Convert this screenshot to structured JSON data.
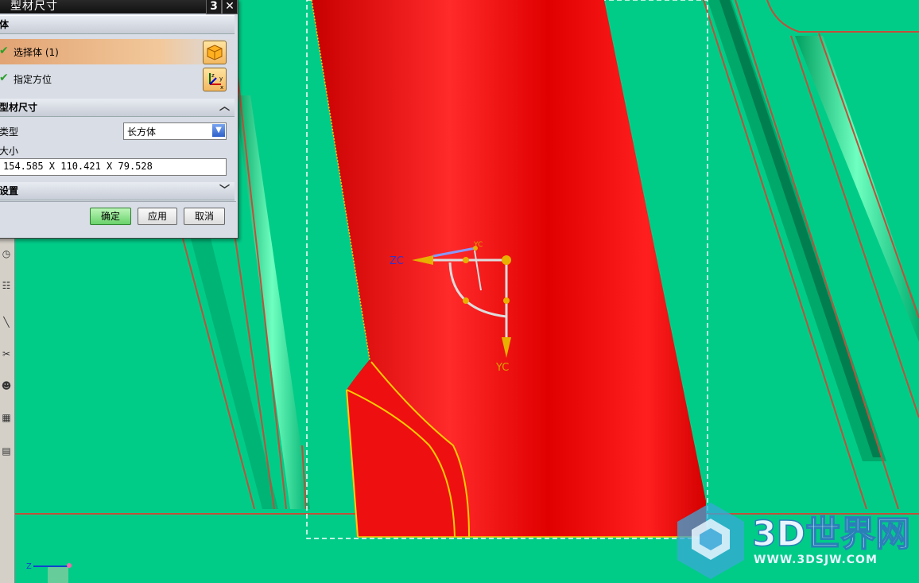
{
  "dialog": {
    "title": "型材尺寸",
    "btn_reset": "3",
    "btn_close": "✕",
    "section_body": "体",
    "select_body_label": "选择体 (1)",
    "specify_orient_label": "指定方位",
    "section_dims": "型材尺寸",
    "type_label": "类型",
    "type_value": "长方体",
    "size_label": "大小",
    "size_value": "154.585 X 110.421 X 79.528",
    "section_settings": "设置",
    "ok": "确定",
    "apply": "应用",
    "cancel": "取消"
  },
  "manipulator": {
    "zc_label": "ZC",
    "yc_label": "YC",
    "yc_small_label": "YC"
  },
  "triad": {
    "z_label": "Z"
  },
  "watermark": {
    "brand": "3D世界网",
    "url": "WWW.3DSJW.COM"
  },
  "colors": {
    "background": "#00cc88",
    "part": "#e00000",
    "edge": "#c0503a",
    "accent_yellow": "#ffcc00"
  }
}
